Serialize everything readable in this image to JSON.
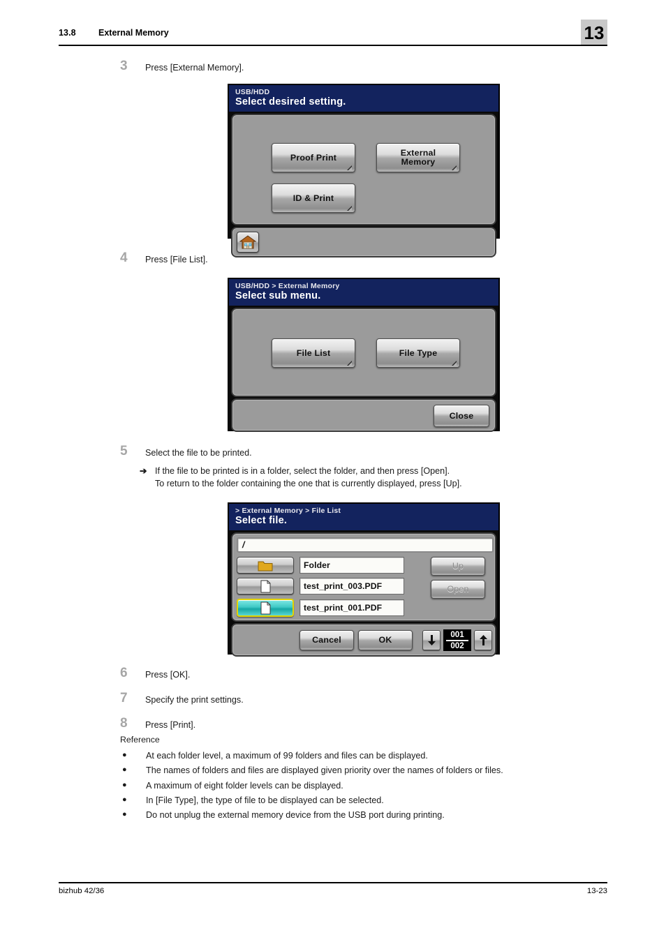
{
  "header": {
    "section_number": "13.8",
    "section_title": "External Memory",
    "chapter_number": "13"
  },
  "steps": [
    {
      "num": "3",
      "text": "Press [External Memory]."
    },
    {
      "num": "4",
      "text": "Press [File List]."
    },
    {
      "num": "5",
      "text": "Select the file to be printed."
    },
    {
      "num": "6",
      "text": "Press [OK]."
    },
    {
      "num": "7",
      "text": "Specify the print settings."
    },
    {
      "num": "8",
      "text": "Press [Print]."
    }
  ],
  "substep": {
    "arrow": "➔",
    "line1": "If the file to be printed is in a folder, select the folder, and then press [Open].",
    "line2": "To return to the folder containing the one that is currently displayed, press [Up]."
  },
  "reference": {
    "title": "Reference",
    "bullet": "●",
    "items": [
      "At each folder level, a maximum of 99 folders and files can be displayed.",
      "The names of folders and files are displayed given priority over the names of folders or files.",
      "A maximum of eight folder levels can be displayed.",
      "In [File Type], the type of file to be displayed can be selected.",
      "Do not unplug the external memory device from the USB port during printing."
    ]
  },
  "footer": {
    "product": "bizhub 42/36",
    "page": "13-23"
  },
  "panel1": {
    "crumb": "USB/HDD",
    "heading": "Select desired setting.",
    "buttons": {
      "proof_print": "Proof Print",
      "external_memory_line1": "External",
      "external_memory_line2": "Memory",
      "id_and_print": "ID & Print"
    },
    "home_icon": "house-icon"
  },
  "panel2": {
    "crumb": "USB/HDD > External Memory",
    "heading": "Select sub menu.",
    "buttons": {
      "file_list": "File List",
      "file_type": "File Type",
      "close": "Close"
    }
  },
  "panel3": {
    "crumb": "> External Memory > File List",
    "heading": "Select file.",
    "path_value": "/",
    "rows": [
      {
        "icon": "folder-icon",
        "name": "Folder",
        "selected": false
      },
      {
        "icon": "document-icon",
        "name": "test_print_003.PDF",
        "selected": false
      },
      {
        "icon": "document-icon",
        "name": "test_print_001.PDF",
        "selected": true
      }
    ],
    "buttons": {
      "up": "Up",
      "open": "Open",
      "cancel": "Cancel",
      "ok": "OK"
    },
    "page_counter": {
      "current": "001",
      "total": "002"
    },
    "nav_down_icon": "arrow-down-icon",
    "nav_up_icon": "arrow-up-icon"
  },
  "colors": {
    "panel_title_bg": "#13235e",
    "panel_body_bg": "#9b9b9b",
    "selected_row": "#16a7a5",
    "selected_border": "#e3d400",
    "folder_icon": "#e0a81e",
    "step_number": "#a6a6a6",
    "chapter_box": "#c8c8c8"
  }
}
